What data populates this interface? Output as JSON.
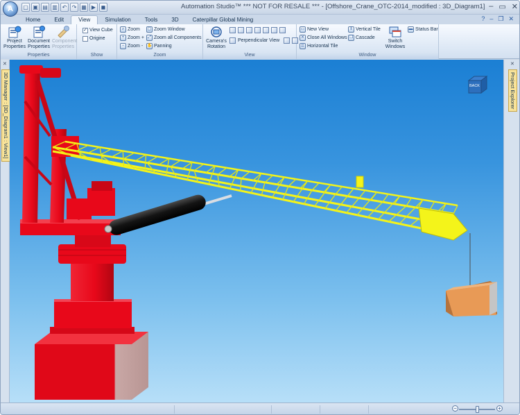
{
  "app": {
    "title": "Automation Studio™  *** NOT FOR RESALE ***  - [Offshore_Crane_OTC-2014_modified : 3D_Diagram1]",
    "logo_letter": "A"
  },
  "window_controls": {
    "minimize": "–",
    "maximize": "▭",
    "close": "✕"
  },
  "quick_access": [
    "new-icon",
    "save-icon",
    "save-all-icon",
    "open-icon",
    "undo-icon",
    "redo-icon",
    "print-icon",
    "run-icon",
    "stop-icon"
  ],
  "quick_access_glyphs": [
    "▢",
    "▣",
    "▤",
    "▥",
    "↶",
    "↷",
    "▦",
    "▶",
    "◼"
  ],
  "tabs": [
    {
      "label": "Home",
      "active": false
    },
    {
      "label": "Edit",
      "active": false
    },
    {
      "label": "View",
      "active": true
    },
    {
      "label": "Simulation",
      "active": false
    },
    {
      "label": "Tools",
      "active": false
    },
    {
      "label": "3D",
      "active": false
    },
    {
      "label": "Caterpillar Global Mining",
      "active": false
    }
  ],
  "help_controls": {
    "help": "?",
    "minimize": "–",
    "restore": "❐",
    "close": "✕"
  },
  "ribbon": {
    "properties": {
      "label": "Properties",
      "project": "Project Properties",
      "document": "Document Properties",
      "component": "Component Properties"
    },
    "show": {
      "label": "Show",
      "view_cube": "View Cube",
      "view_cube_checked": "✓",
      "origine": "Origine",
      "origine_checked": ""
    },
    "zoom": {
      "label": "Zoom",
      "zoom": "Zoom",
      "zoom_in": "Zoom +",
      "zoom_out": "Zoom -",
      "zoom_window": "Zoom Window",
      "zoom_all": "Zoom all Components",
      "panning": "Panning"
    },
    "view": {
      "label": "View",
      "camera_rotation": "Camera's Rotation",
      "perpendicular_view": "Perpendicular View"
    },
    "window": {
      "label": "Window",
      "new_view": "New View",
      "close_all": "Close All Windows",
      "horizontal_tile": "Horizontal Tile",
      "vertical_tile": "Vertical Tile",
      "cascade": "Cascade",
      "switch_windows": "Switch Windows",
      "status_bar": "Status Bar"
    }
  },
  "left_panel": {
    "label": "3D Manager : [3D_Diagram1 : View1]",
    "pin": "✕"
  },
  "right_panel": {
    "label": "Project Explorer",
    "pin": "✕"
  },
  "viewcube": {
    "label": "BACK"
  },
  "colors": {
    "crane_tower": "#e8081a",
    "boom": "#f4f41a",
    "cylinder": "#141414",
    "load_box": "#e89a56",
    "sky_top": "#1b7fd4",
    "sky_bottom": "#b7dff8"
  },
  "statusbar": {
    "zoom_minus": "−",
    "zoom_plus": "+",
    "zoom_level": 0.5
  }
}
